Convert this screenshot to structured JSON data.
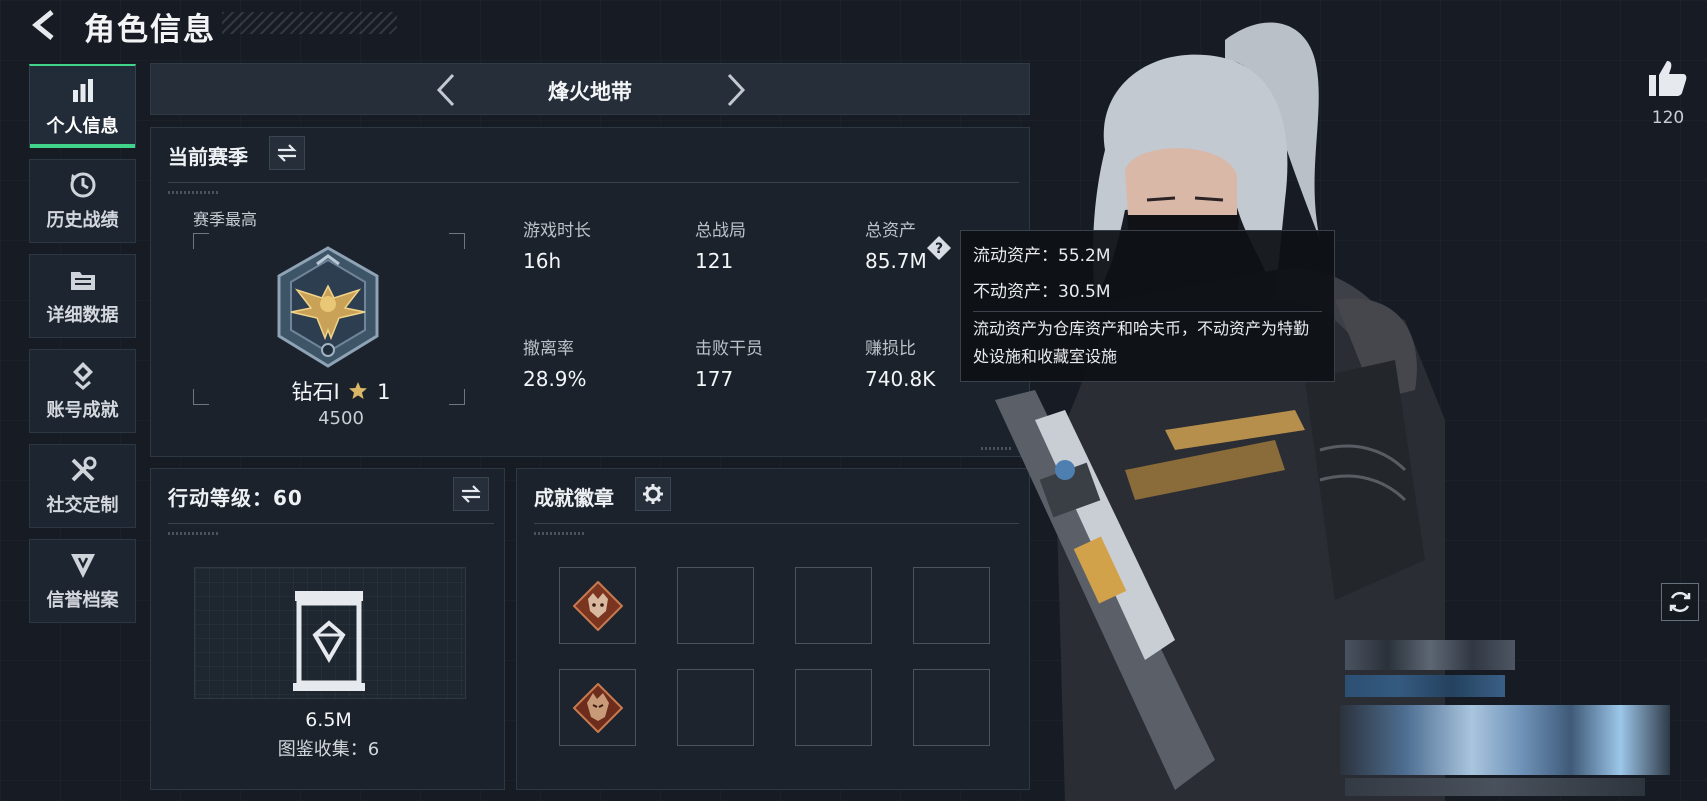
{
  "header": {
    "title": "角色信息"
  },
  "nav": {
    "items": [
      {
        "label": "个人信息",
        "icon": "bar-chart-icon",
        "active": true
      },
      {
        "label": "历史战绩",
        "icon": "history-icon",
        "active": false
      },
      {
        "label": "详细数据",
        "icon": "folder-icon",
        "active": false
      },
      {
        "label": "账号成就",
        "icon": "achievement-icon",
        "active": false
      },
      {
        "label": "社交定制",
        "icon": "tools-icon",
        "active": false
      },
      {
        "label": "信誉档案",
        "icon": "credit-shield-icon",
        "active": false
      }
    ]
  },
  "mode": {
    "title": "烽火地带"
  },
  "season": {
    "title": "当前赛季",
    "best_label": "赛季最高",
    "rank_name": "钻石Ⅰ",
    "rank_stars": "1",
    "rank_score": "4500",
    "stats": [
      {
        "label": "游戏时长",
        "value": "16h"
      },
      {
        "label": "总战局",
        "value": "121"
      },
      {
        "label": "总资产",
        "value": "85.7M"
      },
      {
        "label": "撤离率",
        "value": "28.9%"
      },
      {
        "label": "击败干员",
        "value": "177"
      },
      {
        "label": "赚损比",
        "value": "740.8K"
      }
    ]
  },
  "tooltip": {
    "liquid": "流动资产：55.2M",
    "fixed": "不动资产：30.5M",
    "description": "流动资产为仓库资产和哈夫币，不动资产为特勤处设施和收藏室设施"
  },
  "action": {
    "title": "行动等级：60",
    "asset_value": "6.5M",
    "collection": "图鉴收集：6"
  },
  "badges": {
    "title": "成就徽章",
    "slots": [
      "wolf-badge",
      "empty",
      "empty",
      "empty",
      "dragon-badge",
      "empty",
      "empty",
      "empty"
    ]
  },
  "social": {
    "like_count": "120"
  },
  "colors": {
    "accent": "#3fd489",
    "panel": "#1b222c",
    "background": "#171c24"
  }
}
